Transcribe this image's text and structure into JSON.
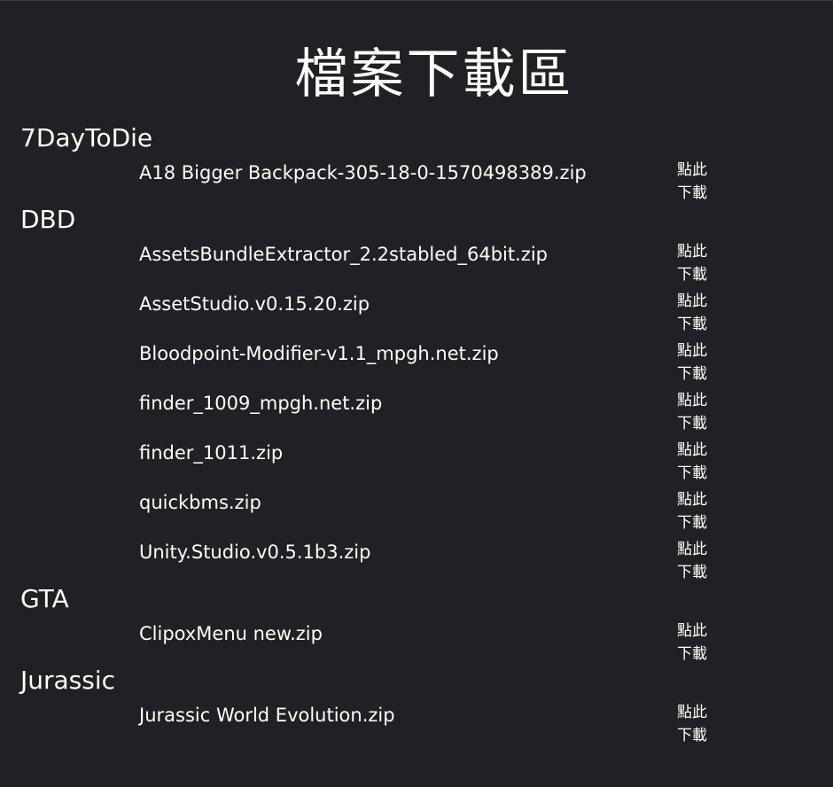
{
  "page": {
    "title": "檔案下載區"
  },
  "download_label": "點此下載",
  "sections": [
    {
      "name": "7DayToDie",
      "files": [
        "A18 Bigger Backpack-305-18-0-1570498389.zip"
      ]
    },
    {
      "name": "DBD",
      "files": [
        "AssetsBundleExtractor_2.2stabled_64bit.zip",
        "AssetStudio.v0.15.20.zip",
        "Bloodpoint-Modifier-v1.1_mpgh.net.zip",
        "finder_1009_mpgh.net.zip",
        "finder_1011.zip",
        "quickbms.zip",
        "Unity.Studio.v0.5.1b3.zip"
      ]
    },
    {
      "name": "GTA",
      "files": [
        "ClipoxMenu new.zip"
      ]
    },
    {
      "name": "Jurassic",
      "files": [
        "Jurassic World Evolution.zip"
      ]
    }
  ],
  "colors": {
    "background": "#202124",
    "text": "#ffffff"
  }
}
